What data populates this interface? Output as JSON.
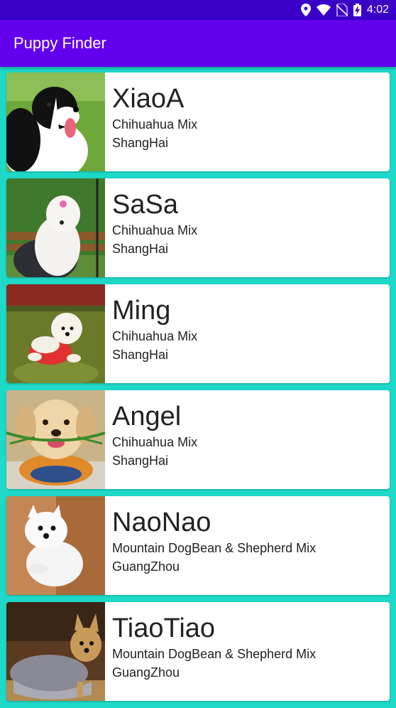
{
  "status_bar": {
    "time": "4:02",
    "icons": [
      "location-icon",
      "wifi-icon",
      "no-sim-icon",
      "battery-charging-icon"
    ]
  },
  "app_bar": {
    "title": "Puppy Finder"
  },
  "puppies": [
    {
      "name": "XiaoA",
      "breed": "Chihuahua Mix",
      "city": "ShangHai",
      "photo": "border-collie-photo"
    },
    {
      "name": "SaSa",
      "breed": "Chihuahua Mix",
      "city": "ShangHai",
      "photo": "sheepdog-photo"
    },
    {
      "name": "Ming",
      "breed": "Chihuahua Mix",
      "city": "ShangHai",
      "photo": "maltese-photo"
    },
    {
      "name": "Angel",
      "breed": "Chihuahua Mix",
      "city": "ShangHai",
      "photo": "labrador-puppy-photo"
    },
    {
      "name": "NaoNao",
      "breed": "Mountain DogBean & Shepherd Mix",
      "city": "GuangZhou",
      "photo": "pomeranian-photo"
    },
    {
      "name": "TiaoTiao",
      "breed": "Mountain DogBean & Shepherd Mix",
      "city": "GuangZhou",
      "photo": "yorkshire-terrier-photo"
    }
  ],
  "colors": {
    "status_bar": "#3a00c8",
    "app_bar": "#6200ee",
    "list_background": "#1ed8c8",
    "card": "#ffffff",
    "text": "#222222"
  }
}
